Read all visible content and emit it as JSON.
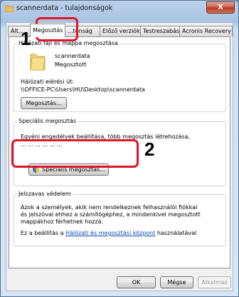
{
  "window": {
    "title": "scannerdata - tulajdonságok",
    "close_label": "X"
  },
  "tabs": [
    {
      "label": "Ált..."
    },
    {
      "label": "Megosztás"
    },
    {
      "label": "...tonság"
    },
    {
      "label": "Előző verziók"
    },
    {
      "label": "Testreszabás"
    },
    {
      "label": "Acronis Recovery"
    }
  ],
  "network_sharing": {
    "group_title": "Hálózati fájl és mappa megosztása",
    "folder_name": "scannerdata",
    "folder_status": "Megosztott",
    "path_label": "Hálózati elérési út:",
    "path_value": "\\\\OFFICE-PC\\Users\\HU\\Desktop\\scannerdata",
    "share_button": "Megosztás..."
  },
  "advanced_sharing": {
    "group_title": "Speciális megosztás",
    "description_line1": "Egyéni engedélyek beállítása, több megosztás létrehozása,",
    "description_line2": "... ... ... ... ... ...",
    "button": "Speciális megosztás..."
  },
  "password_protection": {
    "group_title": "Jelszavas védelem",
    "line1": "Azok a személyek, akik nem rendelkeznek felhasználói fiókkal",
    "line2": "és jelszóval ehhez a számítógéphez, a mindenkivel megosztott",
    "line3": "mappákhoz férhetnek hozzá.",
    "change_prefix": "Ez a beállítás a ",
    "change_link": "Hálózati és megosztási központ",
    "change_suffix": " használatával"
  },
  "footer": {
    "ok": "OK",
    "cancel": "Mégse",
    "apply": "Alkalmaz"
  },
  "annotations": {
    "step1": "1",
    "step2": "2"
  },
  "colors": {
    "highlight": "#e3142a",
    "link": "#0645ad"
  }
}
